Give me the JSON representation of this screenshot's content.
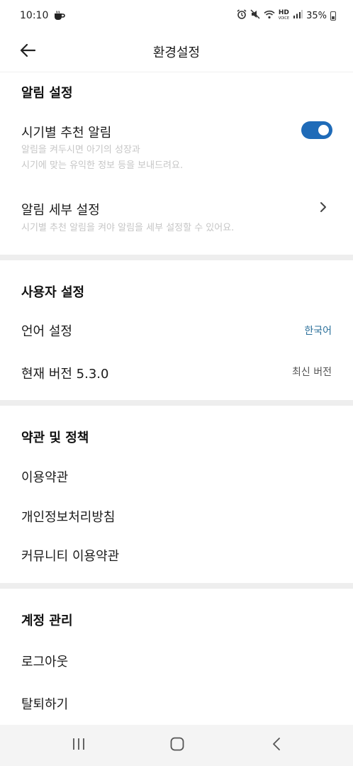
{
  "status_bar": {
    "time": "10:10",
    "battery": "35%"
  },
  "header": {
    "title": "환경설정"
  },
  "notification": {
    "section_title": "알림 설정",
    "seasonal": {
      "title": "시기별 추천 알림",
      "desc_line1": "알림을 켜두시면 아기의 성장과",
      "desc_line2": "시기에 맞는 유익한 정보 등을 보내드려요.",
      "enabled": true
    },
    "detail": {
      "title": "알림 세부 설정",
      "desc": "시기별 추천 알림을 켜야 알림을 세부 설정할 수 있어요."
    }
  },
  "user": {
    "section_title": "사용자 설정",
    "language": {
      "title": "언어 설정",
      "value": "한국어"
    },
    "version": {
      "title": "현재 버전 5.3.0",
      "value": "최신 버전"
    }
  },
  "terms": {
    "section_title": "약관 및 정책",
    "items": [
      "이용약관",
      "개인정보처리방침",
      "커뮤니티 이용약관"
    ]
  },
  "account": {
    "section_title": "계정 관리",
    "logout": "로그아웃",
    "withdraw": "탈퇴하기"
  },
  "colors": {
    "accent": "#1f6bb8",
    "language_value": "#2a6f9a",
    "divider": "#eeeeee",
    "muted": "#c6c6c6"
  },
  "icons": {
    "back": "arrow-left-icon",
    "chevron": "chevron-right-icon",
    "recents": "recents-icon",
    "home": "home-icon",
    "nav_back": "nav-back-icon"
  }
}
